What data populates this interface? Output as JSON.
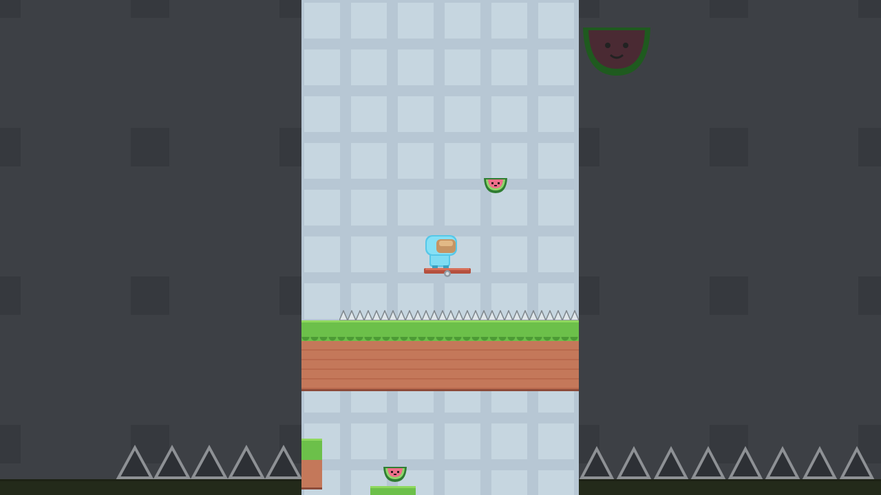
{
  "scene": {
    "name": "platformer-level",
    "colors": {
      "background_tile_light": "#c6d6e0",
      "background_tile_dark": "#b7c7d4",
      "grass": "#6cc04a",
      "dirt": "#c4785a",
      "side_panel": "#404348"
    }
  },
  "objects": {
    "player": {
      "icon": "astronaut-player-icon"
    },
    "hover_board": {
      "icon": "hoverboard-icon"
    },
    "fruits": [
      {
        "icon": "watermelon-icon"
      },
      {
        "icon": "watermelon-icon"
      }
    ],
    "hazards": {
      "icon": "spike-icon"
    }
  }
}
